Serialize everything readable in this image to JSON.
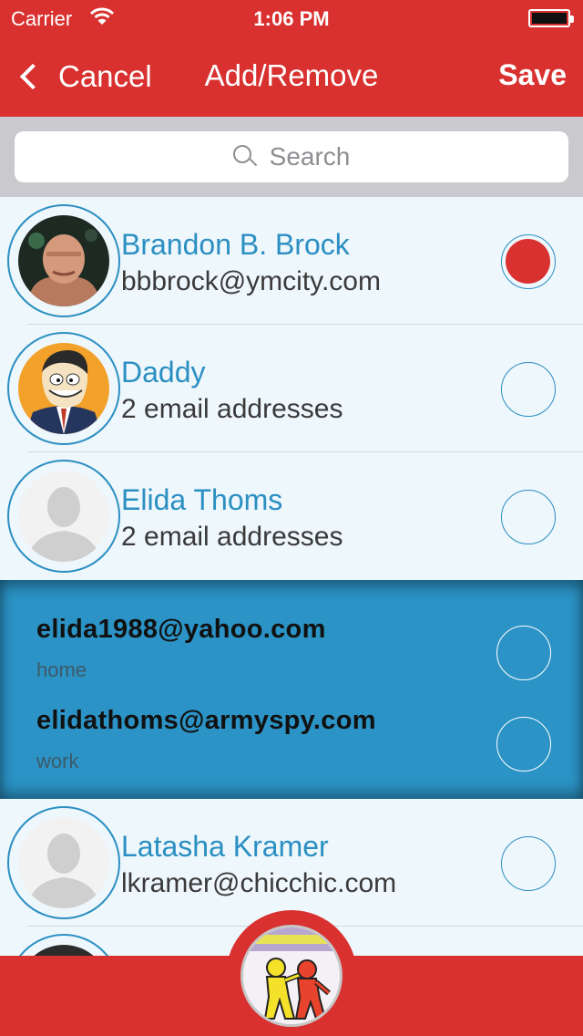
{
  "status_bar": {
    "carrier": "Carrier",
    "time": "1:06 PM"
  },
  "nav": {
    "cancel_label": "Cancel",
    "title": "Add/Remove",
    "save_label": "Save"
  },
  "search": {
    "placeholder": "Search"
  },
  "contacts": [
    {
      "name": "Brandon B. Brock",
      "detail": "bbbrock@ymcity.com",
      "selected": true
    },
    {
      "name": "Daddy",
      "detail": "2 email addresses",
      "selected": false
    },
    {
      "name": "Elida Thoms",
      "detail": "2 email addresses",
      "selected": false
    }
  ],
  "expanded_emails": [
    {
      "email": "elida1988@yahoo.com",
      "label": "home",
      "selected": false
    },
    {
      "email": "elidathoms@armyspy.com",
      "label": "work",
      "selected": false
    }
  ],
  "contacts_after": [
    {
      "name": "Latasha Kramer",
      "detail": "lkramer@chicchic.com",
      "selected": false
    }
  ],
  "colors": {
    "accent_red": "#d8312f",
    "accent_blue": "#2b8fc2",
    "expanded_bg": "#2b93c5",
    "list_bg": "#eef7fc"
  }
}
